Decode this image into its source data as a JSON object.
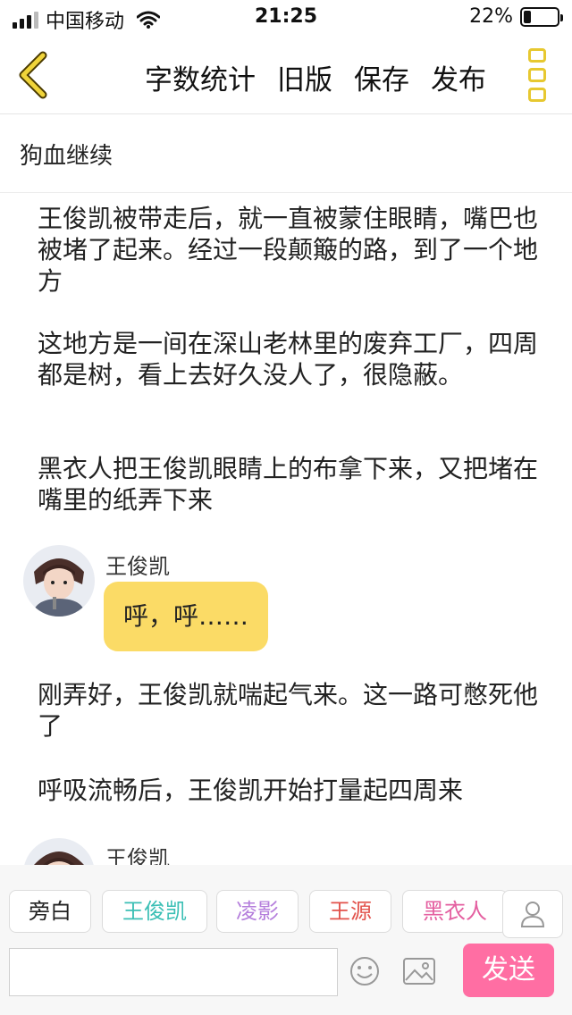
{
  "status_bar": {
    "carrier": "中国移动",
    "time": "21:25",
    "battery_percent": "22%",
    "battery_level": 0.22
  },
  "nav": {
    "back_icon": "chevron-left-icon",
    "actions": [
      "字数统计",
      "旧版",
      "保存",
      "发布"
    ],
    "more_icon": "more-vertical-icon",
    "accent_color": "#e7c830"
  },
  "story": {
    "title": "狗血继续"
  },
  "content": {
    "para1": "王俊凯被带走后，就一直被蒙住眼睛，嘴巴也被堵了起来。经过一段颠簸的路，到了一个地方",
    "para2": "这地方是一间在深山老林里的废弃工厂，四周都是树，看上去好久没人了，很隐蔽。",
    "para3": "黑衣人把王俊凯眼睛上的布拿下来，又把堵在嘴里的纸弄下来",
    "dialog1": {
      "speaker": "王俊凯",
      "text": "呼，呼……"
    },
    "para4": "刚弄好，王俊凯就喘起气来。这一路可憋死他了",
    "para5": "呼吸流畅后，王俊凯开始打量起四周来",
    "dialog2": {
      "speaker": "王俊凯"
    }
  },
  "roles": [
    {
      "label": "旁白",
      "color": "#222222"
    },
    {
      "label": "王俊凯",
      "color": "#3bbfb5"
    },
    {
      "label": "凌影",
      "color": "#b57fdc"
    },
    {
      "label": "王源",
      "color": "#e2524b"
    },
    {
      "label": "黑衣人",
      "color": "#e45fa0"
    }
  ],
  "composer": {
    "input_value": "",
    "emoji_icon": "emoji-icon",
    "image_icon": "image-icon",
    "contact_icon": "user-icon",
    "send_label": "发送",
    "send_color": "#ff6ea3",
    "bubble_color": "#fbdb66"
  }
}
